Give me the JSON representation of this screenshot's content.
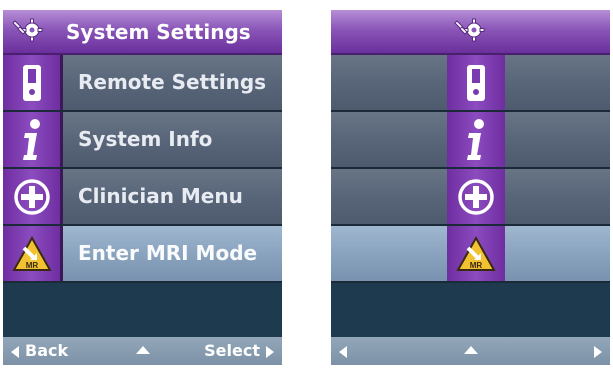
{
  "left_screen": {
    "header": {
      "title": "System Settings",
      "icon": "settings-gear-wrench-icon"
    },
    "menu": [
      {
        "label": "Remote Settings",
        "icon": "remote-control-icon",
        "selected": false
      },
      {
        "label": "System Info",
        "icon": "info-icon",
        "selected": false
      },
      {
        "label": "Clinician Menu",
        "icon": "plus-circle-icon",
        "selected": false
      },
      {
        "label": "Enter MRI Mode",
        "icon": "mri-warning-icon",
        "selected": true
      }
    ],
    "footer": {
      "back_label": "Back",
      "select_label": "Select"
    }
  },
  "right_screen": {
    "header": {
      "icon": "settings-gear-wrench-icon"
    },
    "menu": [
      {
        "icon": "remote-control-icon",
        "selected": false
      },
      {
        "icon": "info-icon",
        "selected": false
      },
      {
        "icon": "plus-circle-icon",
        "selected": false
      },
      {
        "icon": "mri-warning-icon",
        "selected": true
      }
    ]
  },
  "colors": {
    "header_purple": "#8a56b8",
    "icon_column_purple": "#7a3bb0",
    "row_gray": "#59667a",
    "row_selected": "#8aa3bf",
    "background_blue": "#1e3a4f",
    "footer": "#7d92a7"
  }
}
